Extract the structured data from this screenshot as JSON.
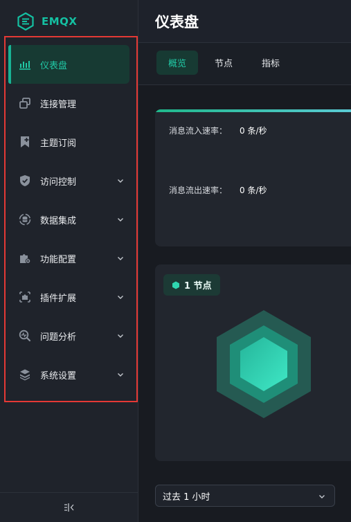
{
  "brand": {
    "name": "EMQX",
    "accent": "#14c0a2"
  },
  "sidebar": {
    "items": [
      {
        "label": "仪表盘",
        "icon": "dashboard-icon",
        "active": true,
        "expandable": false
      },
      {
        "label": "连接管理",
        "icon": "connections-icon",
        "active": false,
        "expandable": false
      },
      {
        "label": "主题订阅",
        "icon": "subscribe-bookmark-icon",
        "active": false,
        "expandable": false
      },
      {
        "label": "访问控制",
        "icon": "shield-icon",
        "active": false,
        "expandable": true
      },
      {
        "label": "数据集成",
        "icon": "data-integration-icon",
        "active": false,
        "expandable": true
      },
      {
        "label": "功能配置",
        "icon": "puzzle-gear-icon",
        "active": false,
        "expandable": true
      },
      {
        "label": "插件扩展",
        "icon": "plugin-icon",
        "active": false,
        "expandable": true
      },
      {
        "label": "问题分析",
        "icon": "diagnose-icon",
        "active": false,
        "expandable": true
      },
      {
        "label": "系统设置",
        "icon": "layers-icon",
        "active": false,
        "expandable": true
      }
    ],
    "collapse_icon": "collapse-sidebar-icon"
  },
  "header": {
    "title": "仪表盘"
  },
  "tabs": [
    {
      "label": "概览",
      "active": true
    },
    {
      "label": "节点",
      "active": false
    },
    {
      "label": "指标",
      "active": false
    }
  ],
  "rates": {
    "inbound_label": "消息流入速率：",
    "inbound_value": "0 条/秒",
    "outbound_label": "消息流出速率：",
    "outbound_value": "0 条/秒"
  },
  "nodes": {
    "badge": "1 节点"
  },
  "time_range": {
    "selected": "过去 1 小时"
  },
  "colors": {
    "active_green": "#21c9a6",
    "highlight_border": "#e53935"
  }
}
